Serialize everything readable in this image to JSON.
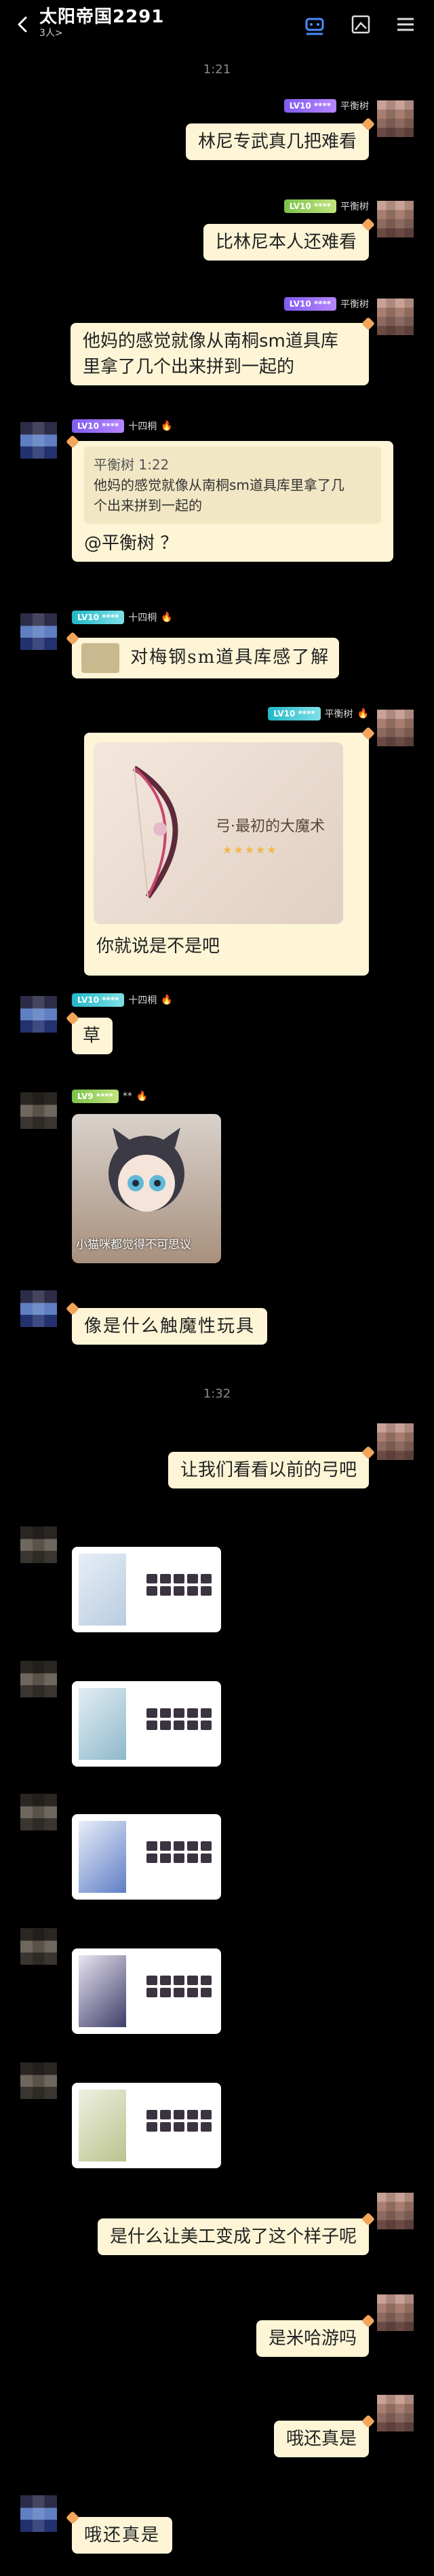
{
  "header": {
    "title": "太阳帝国2291",
    "subtitle": "3人>"
  },
  "timestamps": [
    "1:21",
    "1:32"
  ],
  "messages": {
    "m1": "林尼专武真几把难看",
    "m2": "比林尼本人还难看",
    "m3_line1": "他妈的感觉就像从南桐sm道具库",
    "m3_line2": "里拿了几个出来拼到一起的",
    "m4_quote_time": "平衡树 1:22",
    "m4_quote_line1": "他妈的感觉就像从南桐sm道具库里拿了几",
    "m4_quote_line2": "个出来拼到一起的",
    "m4_reply": "@平衡树 ？",
    "m5": "对梅钢sm道具库感了解",
    "m6_caption": "你就说是不是吧",
    "m6_weapon_name": "弓·最初的大魔术",
    "m6_stars": "★★★★★",
    "m7": "草",
    "m8_caption": "小猫咪都觉得不可思议",
    "m9": "像是什么触魔性玩具",
    "m10": "让我们看看以前的弓吧",
    "m11": "是什么让美工变成了这个样子呢",
    "m12": "是米哈游吗",
    "m13": "哦还真是",
    "m14": "哦还真是"
  },
  "names": {
    "self_tag": "LV10 ****",
    "self_name": "平衡树",
    "blue_tag": "LV10 ****",
    "blue_name": "十四桐",
    "gray_tag": "LV9 ****",
    "gray_name": "**"
  },
  "colors": {
    "bubble": "#fdf5d6",
    "accent_orange": "#f3a65b",
    "topbar_active": "#4d8dff"
  },
  "icons": [
    "back-arrow-icon",
    "robot-icon",
    "screenshot-icon",
    "menu-icon",
    "fire-icon"
  ]
}
